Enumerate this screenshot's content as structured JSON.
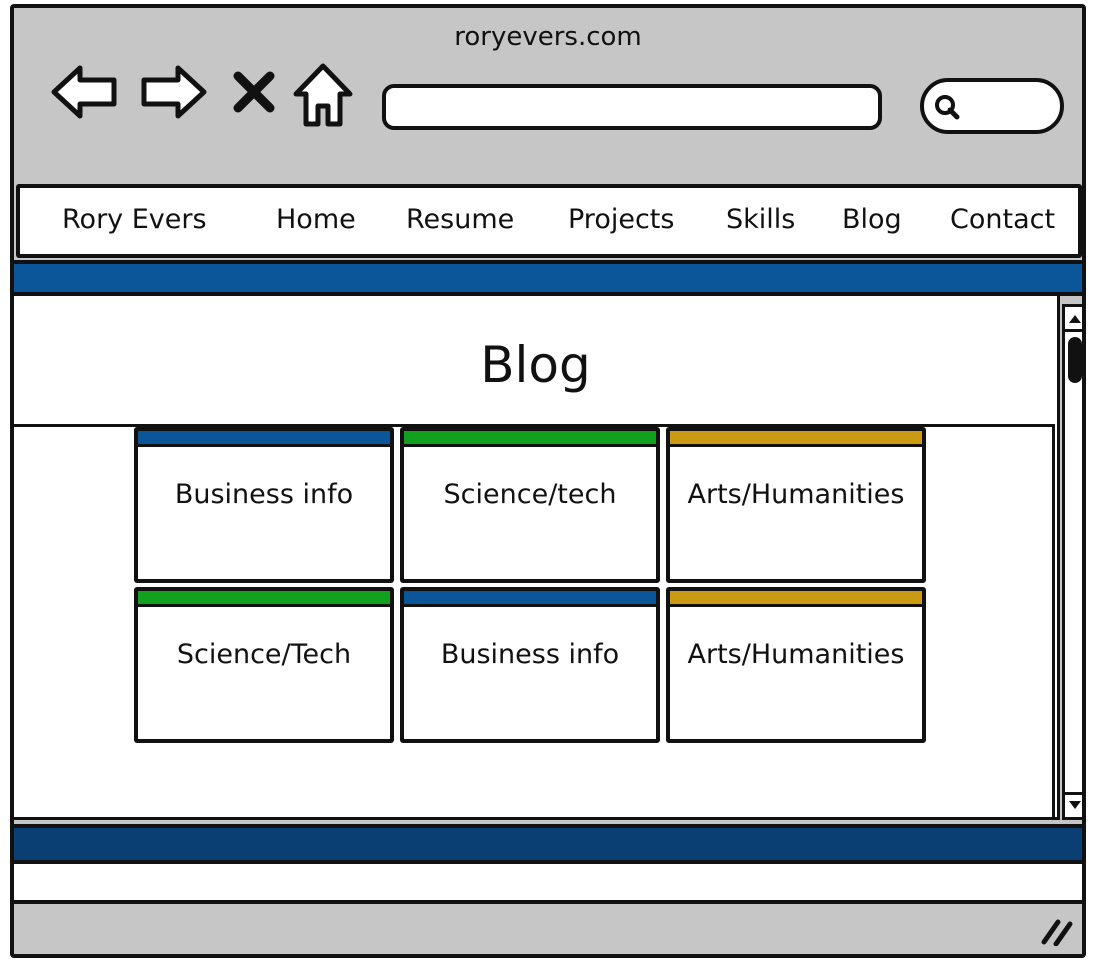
{
  "window": {
    "title": "roryevers.com"
  },
  "browser": {
    "icons": [
      "back-arrow-icon",
      "forward-arrow-icon",
      "close-x-icon",
      "home-icon",
      "search-icon",
      "resize-grip-icon"
    ],
    "address_value": ""
  },
  "nav": {
    "items": [
      {
        "label": "Rory Evers"
      },
      {
        "label": "Home"
      },
      {
        "label": "Resume"
      },
      {
        "label": "Projects"
      },
      {
        "label": "Skills"
      },
      {
        "label": "Blog"
      },
      {
        "label": "Contact"
      }
    ]
  },
  "main": {
    "title": "Blog",
    "cards": [
      {
        "label": "Business info",
        "color": "#0b5599"
      },
      {
        "label": "Science/tech",
        "color": "#11a11e"
      },
      {
        "label": "Arts/Humanities",
        "color": "#c99a12"
      },
      {
        "label": "Science/Tech",
        "color": "#11a11e"
      },
      {
        "label": "Business info",
        "color": "#0b5599"
      },
      {
        "label": "Arts/Humanities",
        "color": "#c99a12"
      }
    ]
  },
  "colors": {
    "chrome": "#c6c6c6",
    "header_stripe": "#0b5599",
    "footer_stripe": "#0a3f73"
  }
}
